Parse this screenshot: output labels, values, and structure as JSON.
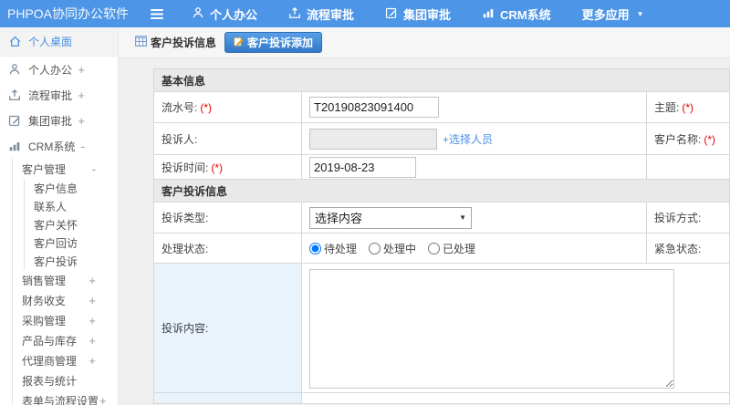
{
  "topbar": {
    "logo": "PHPOA协同办公软件",
    "menu": [
      {
        "label": "个人办公",
        "icon": "person-icon"
      },
      {
        "label": "流程审批",
        "icon": "upload-icon"
      },
      {
        "label": "集团审批",
        "icon": "edit-icon"
      },
      {
        "label": "CRM系统",
        "icon": "bar-chart-icon"
      },
      {
        "label": "更多应用",
        "icon": "caret-down-icon"
      }
    ]
  },
  "sidebar": {
    "desktop": "个人桌面",
    "top_items": [
      {
        "label": "个人办公",
        "expander": "+"
      },
      {
        "label": "流程审批",
        "expander": "+"
      },
      {
        "label": "集团审批",
        "expander": "+"
      },
      {
        "label": "CRM系统",
        "expander": "-"
      }
    ],
    "customer_mgmt": {
      "label": "客户管理",
      "expander": "-"
    },
    "customer_children": [
      "客户信息",
      "联系人",
      "客户关怀",
      "客户回访",
      "客户投诉"
    ],
    "crm_siblings": [
      {
        "label": "销售管理",
        "expander": "+"
      },
      {
        "label": "财务收支",
        "expander": "+"
      },
      {
        "label": "采购管理",
        "expander": "+"
      },
      {
        "label": "产品与库存",
        "expander": "+"
      },
      {
        "label": "代理商管理",
        "expander": "+"
      },
      {
        "label": "报表与统计",
        "expander": ""
      },
      {
        "label": "表单与流程设置",
        "expander": "+"
      }
    ]
  },
  "tabbar": {
    "info_tab": "客户投诉信息",
    "add_button": "客户投诉添加"
  },
  "form": {
    "required_mark": "(*)",
    "section_basic": "基本信息",
    "section_complaint": "客户投诉信息",
    "serial": {
      "label": "流水号:",
      "value": "T20190823091400"
    },
    "subject": {
      "label": "主题:"
    },
    "complainant": {
      "label": "投诉人:",
      "value": "",
      "select_person_link": "+选择人员"
    },
    "customer_name": {
      "label": "客户名称:"
    },
    "complaint_time": {
      "label": "投诉时间:",
      "value": "2019-08-23"
    },
    "complaint_type": {
      "label": "投诉类型:",
      "value": "选择内容"
    },
    "complaint_method": {
      "label": "投诉方式:"
    },
    "handle_status": {
      "label": "处理状态:",
      "options": [
        "待处理",
        "处理中",
        "已处理"
      ],
      "selected": "待处理"
    },
    "urgent_status": {
      "label": "紧急状态:"
    },
    "content": {
      "label": "投诉内容:",
      "value": ""
    }
  },
  "colors": {
    "topbar_blue": "#4d95e6",
    "accent_blue": "#4a90e2",
    "required_red": "#e50000"
  }
}
